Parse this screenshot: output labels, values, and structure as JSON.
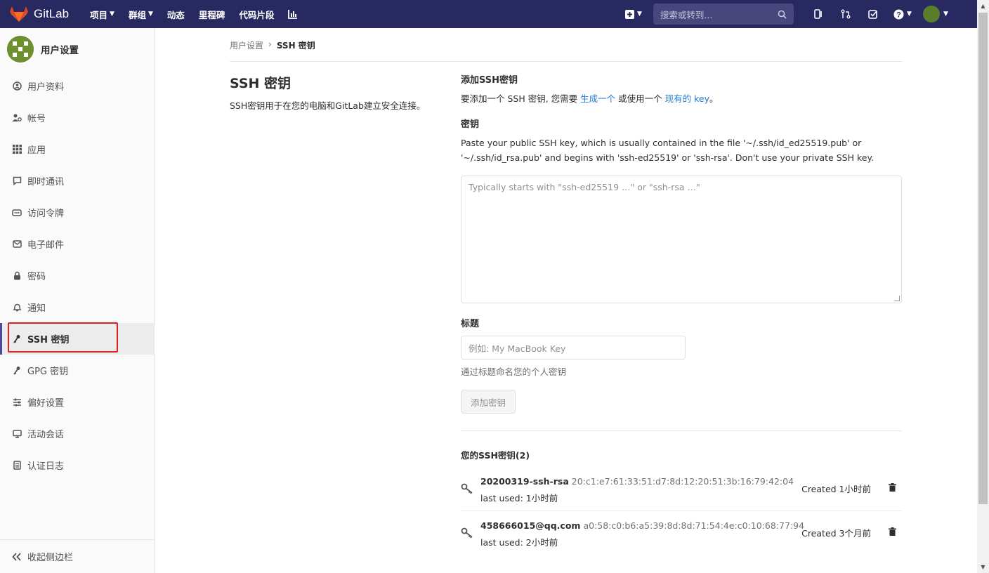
{
  "navbar": {
    "brand": "GitLab",
    "menu": [
      {
        "label": "项目",
        "caret": true
      },
      {
        "label": "群组",
        "caret": true
      },
      {
        "label": "动态",
        "caret": false
      },
      {
        "label": "里程碑",
        "caret": false
      },
      {
        "label": "代码片段",
        "caret": false
      }
    ],
    "search_placeholder": "搜索或转到..."
  },
  "sidebar": {
    "title": "用户设置",
    "items": [
      {
        "label": "用户资料",
        "icon": "user-profile-icon"
      },
      {
        "label": "帐号",
        "icon": "account-icon"
      },
      {
        "label": "应用",
        "icon": "applications-icon"
      },
      {
        "label": "即时通讯",
        "icon": "chat-icon"
      },
      {
        "label": "访问令牌",
        "icon": "token-icon"
      },
      {
        "label": "电子邮件",
        "icon": "mail-icon"
      },
      {
        "label": "密码",
        "icon": "lock-icon"
      },
      {
        "label": "通知",
        "icon": "bell-icon"
      },
      {
        "label": "SSH 密钥",
        "icon": "key-icon",
        "active": true
      },
      {
        "label": "GPG 密钥",
        "icon": "key-icon"
      },
      {
        "label": "偏好设置",
        "icon": "preferences-icon"
      },
      {
        "label": "活动会话",
        "icon": "monitor-icon"
      },
      {
        "label": "认证日志",
        "icon": "log-icon"
      }
    ],
    "collapse_label": "收起侧边栏"
  },
  "breadcrumb": {
    "parent": "用户设置",
    "current": "SSH 密钥"
  },
  "page": {
    "title": "SSH 密钥",
    "description": "SSH密钥用于在您的电脑和GitLab建立安全连接。"
  },
  "form": {
    "heading": "添加SSH密钥",
    "intro_pre": "要添加一个 SSH 密钥, 您需要",
    "intro_link1": "生成一个",
    "intro_mid": "或使用一个",
    "intro_link2": "现有的 key",
    "intro_post": "。",
    "key_label": "密钥",
    "key_help_1": "Paste your public SSH key, which is usually contained in the file '~/.ssh/id_ed25519.pub' or",
    "key_help_2": "'~/.ssh/id_rsa.pub' and begins with 'ssh-ed25519' or 'ssh-rsa'. Don't use your private SSH key.",
    "key_placeholder": "Typically starts with \"ssh-ed25519 …\" or \"ssh-rsa …\"",
    "title_label": "标题",
    "title_placeholder": "例如: My MacBook Key",
    "title_help": "通过标题命名您的个人密钥",
    "submit_label": "添加密钥"
  },
  "keys": {
    "heading": "您的SSH密钥(2)",
    "items": [
      {
        "title": "20200319-ssh-rsa",
        "fingerprint": "20:c1:e7:61:33:51:d7:8d:12:20:51:3b:16:79:42:04",
        "last_used": "last used: 1小时前",
        "created": "Created 1小时前"
      },
      {
        "title": "458666015@qq.com",
        "fingerprint": "a0:58:c0:b6:a5:39:8d:8d:71:54:4e:c0:10:68:77:94",
        "last_used": "last used: 2小时前",
        "created": "Created 3个月前"
      }
    ]
  },
  "colors": {
    "navbar": "#292961",
    "link": "#1f78d1",
    "highlight": "#e02020"
  }
}
